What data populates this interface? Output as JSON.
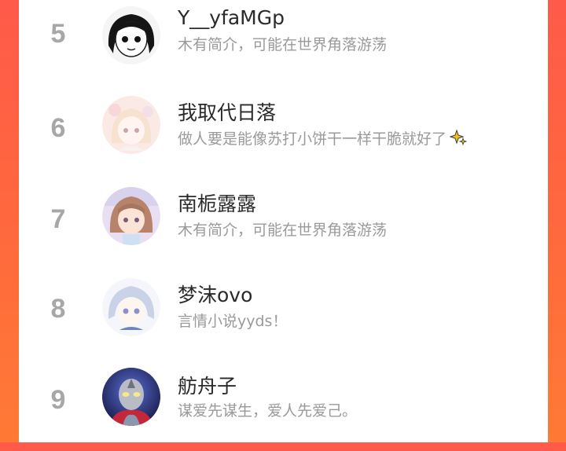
{
  "ranking": {
    "entries": [
      {
        "rank": "5",
        "name": "Y__yfaMGp",
        "bio": "木有简介，可能在世界角落游荡",
        "avatar_icon": "manga-girl-avatar"
      },
      {
        "rank": "6",
        "name": "我取代日落",
        "bio": "做人要是能像苏打小饼干一样干脆就好了",
        "avatar_icon": "pastel-anime-girl-avatar",
        "bio_emoji": "sparkles-icon"
      },
      {
        "rank": "7",
        "name": "南栀露露",
        "bio": "木有简介，可能在世界角落游荡",
        "avatar_icon": "anime-girl-brown-hair-avatar"
      },
      {
        "rank": "8",
        "name": "梦沫ovo",
        "bio": "言情小说yyds！",
        "avatar_icon": "anime-girl-silver-hair-avatar"
      },
      {
        "rank": "9",
        "name": "舫舟子",
        "bio": "谋爱先谋生，爱人先爱己。",
        "avatar_icon": "ultraman-avatar"
      }
    ]
  },
  "colors": {
    "background_gradient_start": "#ff5a4a",
    "background_gradient_end": "#ff7a35",
    "rank_color": "#a7a7a7",
    "name_color": "#2a2a2a",
    "bio_color": "#9a9a9a"
  }
}
